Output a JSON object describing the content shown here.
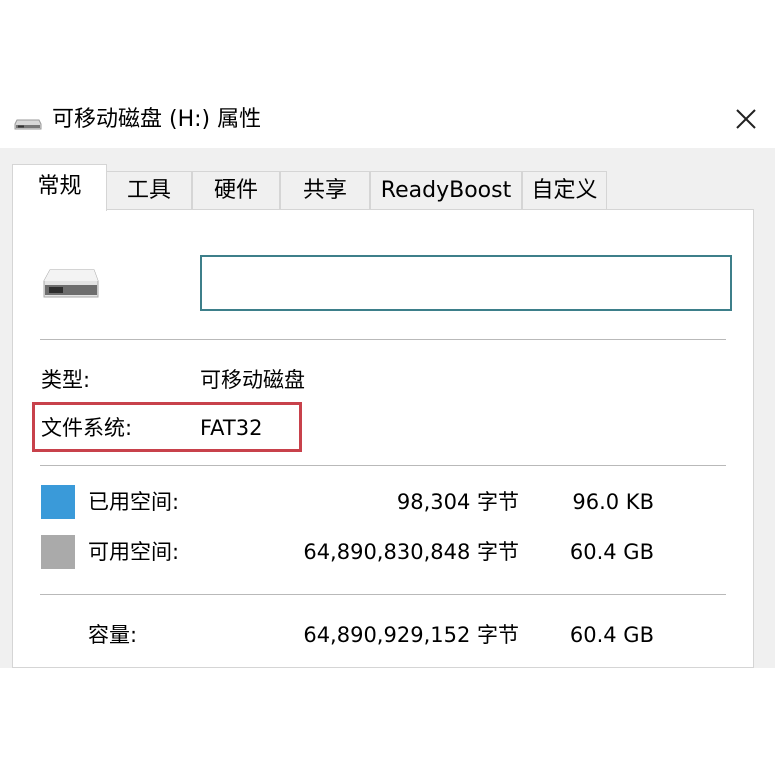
{
  "window": {
    "title": "可移动磁盘 (H:) 属性",
    "close_glyph": "✕"
  },
  "tabs": [
    {
      "label": "常规",
      "active": true
    },
    {
      "label": "工具"
    },
    {
      "label": "硬件"
    },
    {
      "label": "共享"
    },
    {
      "label": "ReadyBoost"
    },
    {
      "label": "自定义"
    }
  ],
  "general": {
    "name_value": "",
    "type_label": "类型:",
    "type_value": "可移动磁盘",
    "fs_label": "文件系统:",
    "fs_value": "FAT32",
    "used": {
      "label": "已用空间:",
      "bytes": "98,304 字节",
      "size": "96.0 KB",
      "color": "#3a9ad9"
    },
    "free": {
      "label": "可用空间:",
      "bytes": "64,890,830,848 字节",
      "size": "60.4 GB",
      "color": "#aaaaaa"
    },
    "capacity": {
      "label": "容量:",
      "bytes": "64,890,929,152 字节",
      "size": "60.4 GB"
    }
  },
  "colors": {
    "highlight": "#c8414b",
    "input_border": "#3d7f8a"
  },
  "icons": [
    "usb-drive-icon",
    "close-icon"
  ]
}
